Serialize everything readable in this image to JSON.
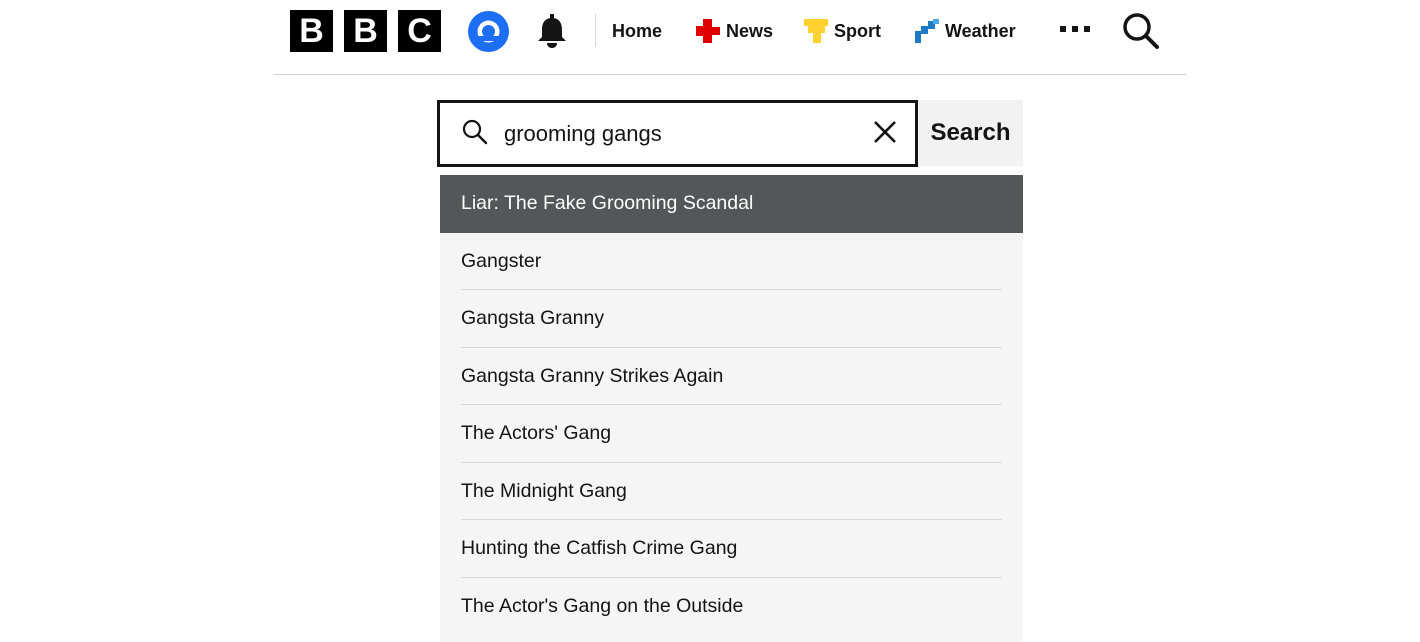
{
  "header": {
    "logo_letters": [
      "B",
      "B",
      "C"
    ],
    "nav": {
      "home": "Home",
      "news": "News",
      "sport": "Sport",
      "weather": "Weather"
    },
    "colors": {
      "news_icon": "#e00000",
      "sport_icon": "#ffd230",
      "weather_icon": "#1f7ac6",
      "account_icon": "#1c6ff4"
    },
    "icons": [
      "account-icon",
      "notifications-bell-icon",
      "more-icon",
      "search-icon"
    ]
  },
  "search": {
    "value": "grooming gangs",
    "button_label": "Search"
  },
  "suggestions": [
    {
      "label": "Liar: The Fake Grooming Scandal",
      "highlighted": true
    },
    {
      "label": "Gangster"
    },
    {
      "label": "Gangsta Granny"
    },
    {
      "label": "Gangsta Granny Strikes Again"
    },
    {
      "label": "The Actors' Gang"
    },
    {
      "label": "The Midnight Gang"
    },
    {
      "label": "Hunting the Catfish Crime Gang"
    },
    {
      "label": "The Actor's Gang on the Outside"
    }
  ]
}
